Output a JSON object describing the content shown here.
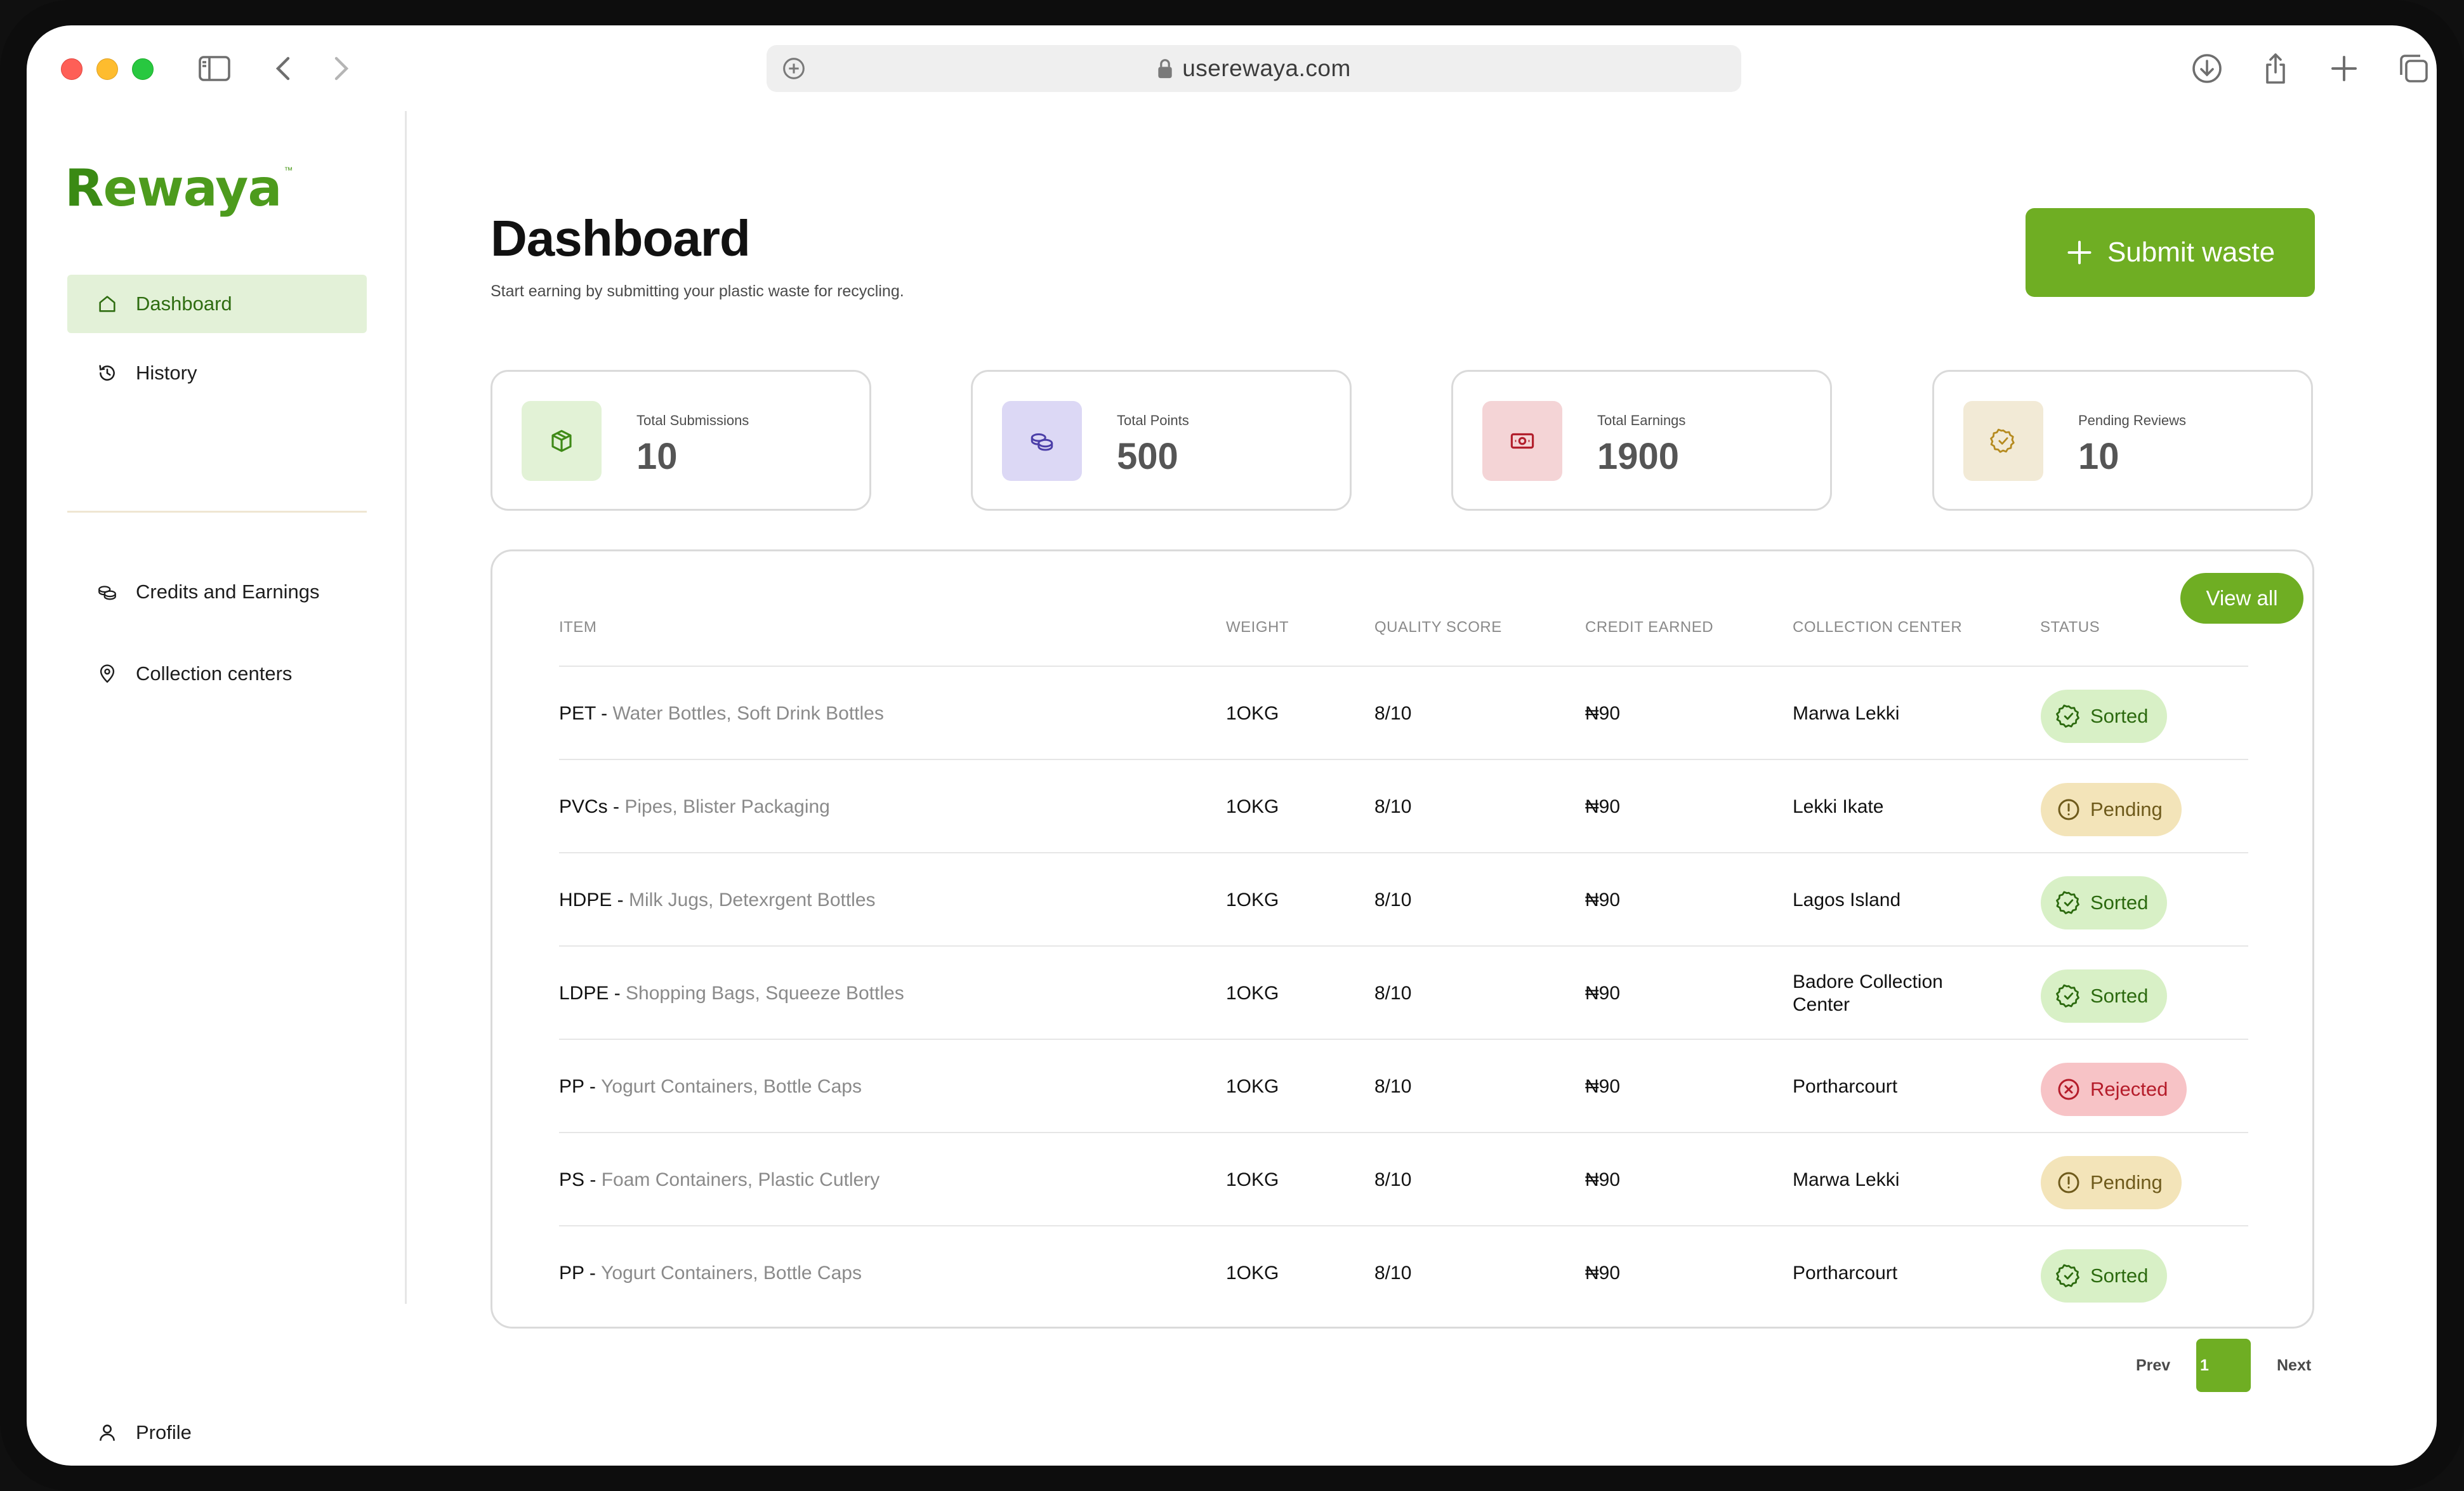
{
  "browser": {
    "url": "userewaya.com"
  },
  "brand": {
    "logo_text_first": "R",
    "logo_text_rest": "ewaya",
    "trademark": "™",
    "accent_color": "#6fae23"
  },
  "sidebar": {
    "items": [
      {
        "label": "Dashboard",
        "icon": "home-icon",
        "active": true
      },
      {
        "label": "History",
        "icon": "history-icon",
        "active": false
      },
      {
        "label": "Credits and Earnings",
        "icon": "coins-icon",
        "active": false
      },
      {
        "label": "Collection centers",
        "icon": "location-pin-icon",
        "active": false
      }
    ],
    "profile_label": "Profile"
  },
  "header": {
    "title": "Dashboard",
    "subtitle": "Start earning by submitting your plastic waste for recycling.",
    "submit_label": "Submit waste"
  },
  "stats": [
    {
      "label": "Total Submissions",
      "value": "10",
      "icon": "box-icon",
      "bg": "#e2f2d6",
      "fg": "#3f8a17"
    },
    {
      "label": "Total Points",
      "value": "500",
      "icon": "coins-icon",
      "bg": "#dcd8f5",
      "fg": "#4b3ea8"
    },
    {
      "label": "Total Earnings",
      "value": "1900",
      "icon": "cash-icon",
      "bg": "#f4d4d6",
      "fg": "#b21f2d"
    },
    {
      "label": "Pending Reviews",
      "value": "10",
      "icon": "badge-check-icon",
      "bg": "#f2ead6",
      "fg": "#b58a1e"
    }
  ],
  "table": {
    "view_all_label": "View all",
    "columns": [
      "ITEM",
      "WEIGHT",
      "QUALITY SCORE",
      "CREDIT EARNED",
      "COLLECTION CENTER",
      "STATUS"
    ],
    "rows": [
      {
        "code": "PET - ",
        "desc": "Water Bottles, Soft Drink Bottles",
        "weight": "1OKG",
        "quality": "8/10",
        "credit": "₦90",
        "center": "Marwa Lekki",
        "status": "Sorted"
      },
      {
        "code": "PVCs - ",
        "desc": "Pipes, Blister Packaging",
        "weight": "1OKG",
        "quality": "8/10",
        "credit": "₦90",
        "center": "Lekki Ikate",
        "status": "Pending"
      },
      {
        "code": "HDPE - ",
        "desc": "Milk Jugs, Detexrgent Bottles",
        "weight": "1OKG",
        "quality": "8/10",
        "credit": "₦90",
        "center": "Lagos Island",
        "status": "Sorted"
      },
      {
        "code": "LDPE - ",
        "desc": "Shopping Bags, Squeeze Bottles",
        "weight": "1OKG",
        "quality": "8/10",
        "credit": "₦90",
        "center": "Badore Collection Center",
        "status": "Sorted"
      },
      {
        "code": "PP - ",
        "desc": "Yogurt Containers, Bottle Caps",
        "weight": "1OKG",
        "quality": "8/10",
        "credit": "₦90",
        "center": "Portharcourt",
        "status": "Rejected"
      },
      {
        "code": "PS - ",
        "desc": "Foam Containers, Plastic Cutlery",
        "weight": "1OKG",
        "quality": "8/10",
        "credit": "₦90",
        "center": "Marwa Lekki",
        "status": "Pending"
      },
      {
        "code": "PP - ",
        "desc": "Yogurt Containers, Bottle Caps",
        "weight": "1OKG",
        "quality": "8/10",
        "credit": "₦90",
        "center": "Portharcourt",
        "status": "Sorted"
      }
    ]
  },
  "pagination": {
    "prev_label": "Prev",
    "current_page": "1",
    "next_label": "Next"
  }
}
